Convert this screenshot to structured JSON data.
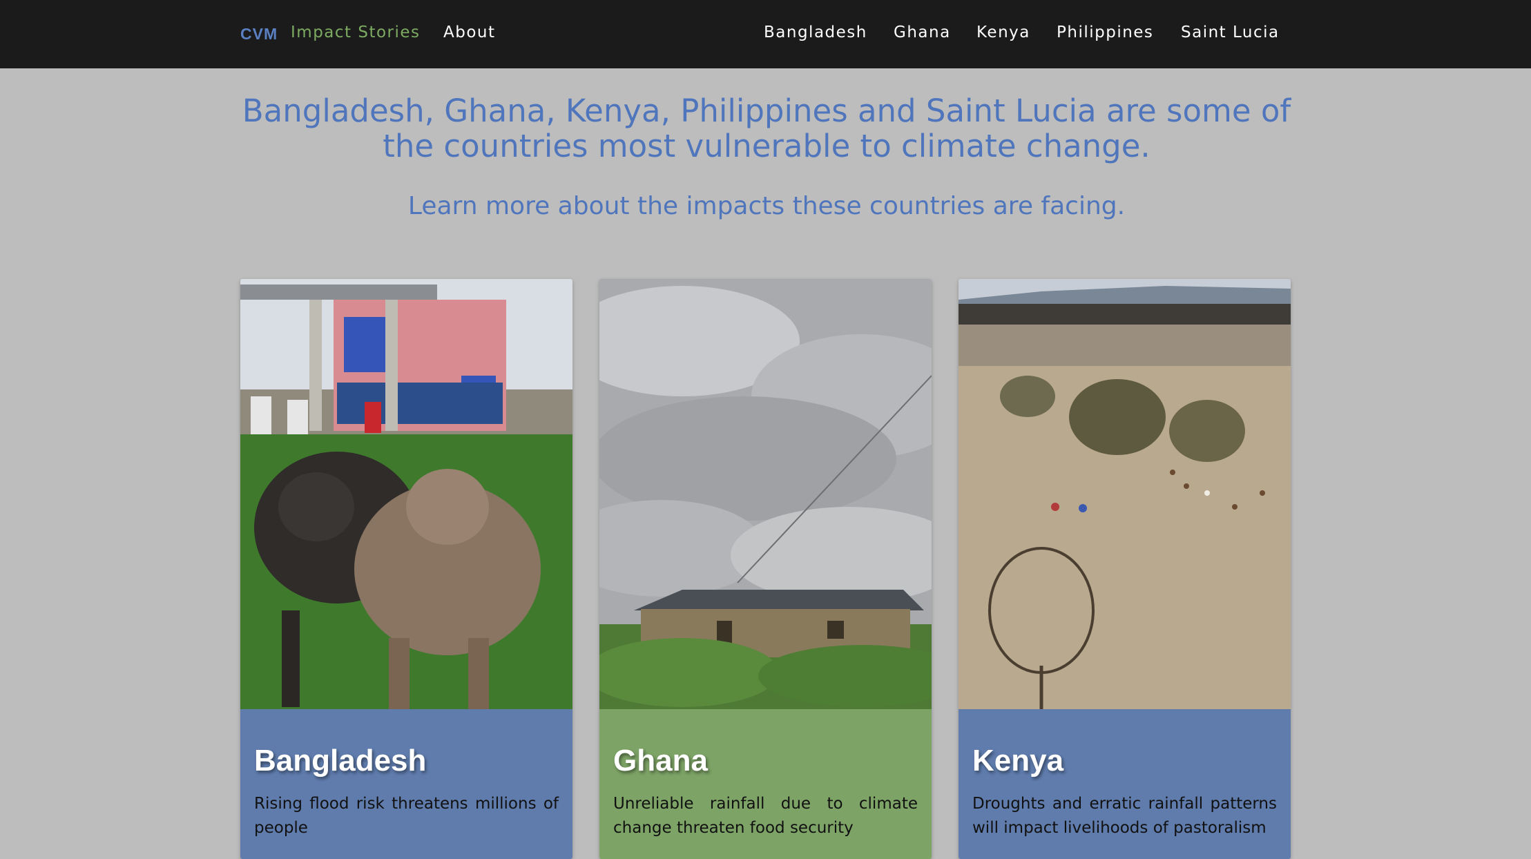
{
  "colors": {
    "nav_bg": "#1b1b1b",
    "page_bg": "#bdbdbd",
    "brand": "#5a80c2",
    "accent_green": "#7dab62",
    "heading_blue": "#4f75bc",
    "card_blue": "#5f7cad",
    "card_green": "#7da366"
  },
  "nav": {
    "brand": "CVM",
    "impact_stories": "Impact Stories",
    "about": "About",
    "countries": [
      "Bangladesh",
      "Ghana",
      "Kenya",
      "Philippines",
      "Saint Lucia"
    ]
  },
  "intro": {
    "headline_line1": "Bangladesh, Ghana, Kenya, Philippines and Saint Lucia are some of",
    "headline_line2": "the countries most vulnerable to climate change.",
    "subline": "Learn more about the impacts these countries are facing."
  },
  "cards": [
    {
      "title": "Bangladesh",
      "text": "Rising flood risk threatens millions of people",
      "color": "#5f7cad"
    },
    {
      "title": "Ghana",
      "text": "Unreliable rainfall due to climate change threaten food security",
      "color": "#7da366"
    },
    {
      "title": "Kenya",
      "text": "Droughts and erratic rainfall patterns will impact livelihoods of pastoralism",
      "color": "#5f7cad"
    }
  ]
}
